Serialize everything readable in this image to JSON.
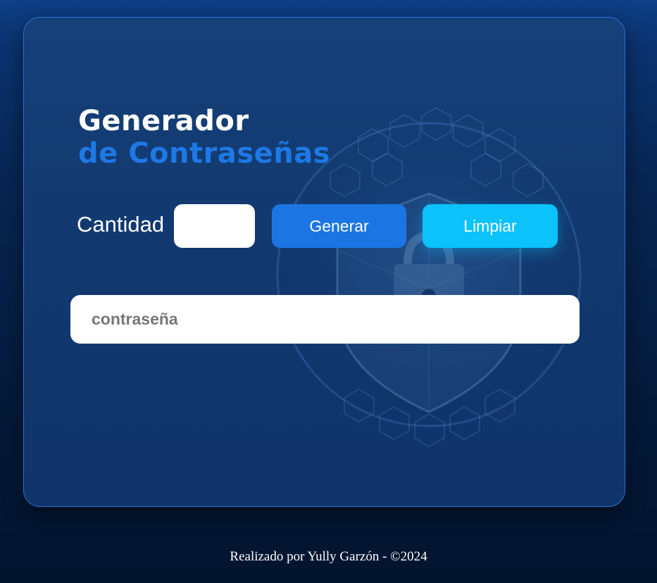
{
  "header": {
    "title_line1": "Generador",
    "title_line2": "de Contraseñas"
  },
  "form": {
    "quantity_label": "Cantidad",
    "quantity_value": "",
    "generate_label": "Generar",
    "clear_label": "Limpiar",
    "password_placeholder": "contraseña",
    "password_value": ""
  },
  "footer": {
    "credit": "Realizado por Yully Garzón - ©2024"
  },
  "colors": {
    "accent": "#1e78e6",
    "generate_button": "#1b76e4",
    "clear_button": "#0cc2fb",
    "background": "#072654"
  },
  "decor": {
    "background_icon": "globe-shield-lock-icon"
  }
}
